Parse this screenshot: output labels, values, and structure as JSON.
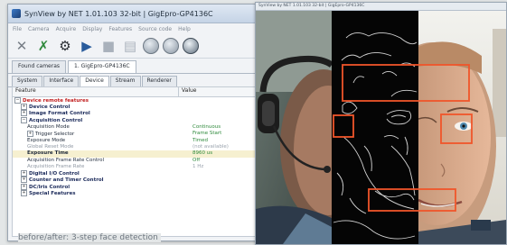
{
  "window": {
    "title": "SynView by NET 1.01.103 32-bit | GigEpro-GP4136C",
    "menu": [
      "File",
      "Camera",
      "Acquire",
      "Display",
      "Features",
      "Source code",
      "Help"
    ]
  },
  "device_tabs": [
    "Found cameras",
    "1. GigEpro-GP4136C"
  ],
  "prop_tabs": [
    "System",
    "Interface",
    "Device",
    "Stream",
    "Renderer"
  ],
  "active_prop_tab": "Device",
  "grid": {
    "col_feature": "Feature",
    "col_value": "Value",
    "rows": [
      {
        "name": "Device remote features",
        "value": "",
        "level": 0,
        "kind": "cat-red",
        "toggle": "−"
      },
      {
        "name": "Device Control",
        "value": "",
        "level": 1,
        "kind": "cat",
        "toggle": "+"
      },
      {
        "name": "Image Format Control",
        "value": "",
        "level": 1,
        "kind": "cat",
        "toggle": "+"
      },
      {
        "name": "Acquisition Control",
        "value": "",
        "level": 1,
        "kind": "cat",
        "toggle": "−"
      },
      {
        "name": "Acquisition Mode",
        "value": "Continuous",
        "level": 2,
        "kind": "feat",
        "toggle": ""
      },
      {
        "name": "Trigger Selector",
        "value": "Frame Start",
        "level": 2,
        "kind": "feat",
        "toggle": "+"
      },
      {
        "name": "Exposure Mode",
        "value": "Timed",
        "level": 2,
        "kind": "feat",
        "toggle": ""
      },
      {
        "name": "Global Reset Mode",
        "value": "(not available)",
        "level": 2,
        "kind": "feat-grey",
        "toggle": ""
      },
      {
        "name": "Exposure Time",
        "value": "8960 us",
        "level": 2,
        "kind": "feat",
        "toggle": "",
        "selected": true
      },
      {
        "name": "Acquisition Frame Rate Control",
        "value": "Off",
        "level": 2,
        "kind": "feat",
        "toggle": ""
      },
      {
        "name": "Acquisition Frame Rate",
        "value": "1 Hz",
        "level": 2,
        "kind": "feat-grey",
        "toggle": ""
      },
      {
        "name": "Digital I/O Control",
        "value": "",
        "level": 1,
        "kind": "cat",
        "toggle": "+"
      },
      {
        "name": "Counter and Timer Control",
        "value": "",
        "level": 1,
        "kind": "cat",
        "toggle": "+"
      },
      {
        "name": "DC/Iris Control",
        "value": "",
        "level": 1,
        "kind": "cat",
        "toggle": "+"
      },
      {
        "name": "Special Features",
        "value": "",
        "level": 1,
        "kind": "cat",
        "toggle": "+"
      }
    ]
  },
  "image_window": {
    "title": "SynView by NET 1.01.103 32-bit | GigEpro-GP4136C"
  },
  "caption": "before/after: 3-step face detection",
  "colors": {
    "detection_box": "#f0552a",
    "category_red": "#c12020",
    "value_green": "#2f8a3c"
  }
}
